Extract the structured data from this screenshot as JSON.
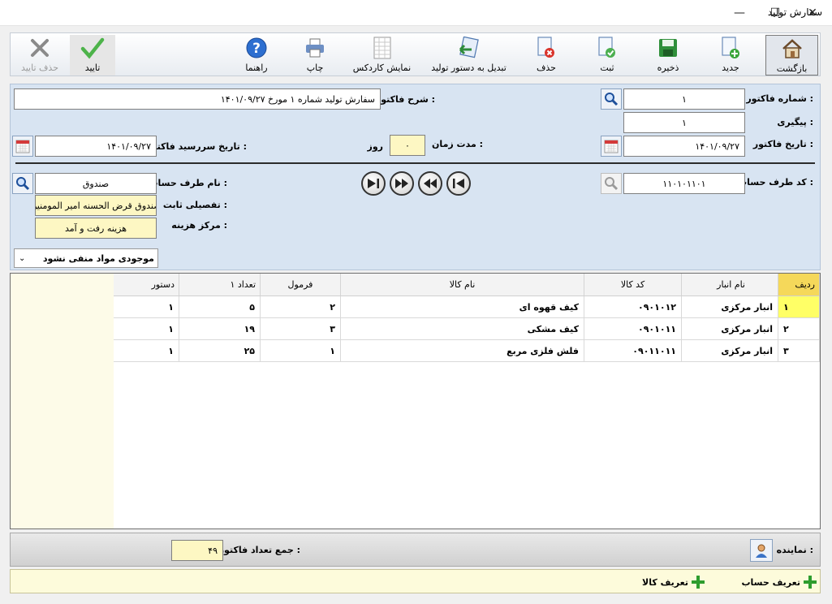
{
  "window": {
    "title": "سفارش تولید",
    "minimize": "—",
    "maximize": "☐",
    "close": "✕"
  },
  "toolbar": {
    "back": "بازگشت",
    "new": "جدید",
    "save": "ذخیره",
    "register": "ثبت",
    "delete": "حذف",
    "convert": "تبدیل به دستور تولید",
    "cardex": "نمایش کاردکس",
    "print": "چاپ",
    "help": "راهنما",
    "confirm": "تایید",
    "delete_confirm": "حذف تایید"
  },
  "form": {
    "invoice_number_label": "شماره فاکتور :",
    "invoice_number": "۱",
    "tracking_label": "پیگیری :",
    "tracking": "۱",
    "description_label": "شرح فاکتور :",
    "description": "سفارش تولید شماره ۱ مورخ ۱۴۰۱/۰۹/۲۷",
    "invoice_date_label": "تاریخ فاکتور :",
    "invoice_date": "۱۴۰۱/۰۹/۲۷",
    "duration_label": "مدت زمان :",
    "duration": "۰",
    "duration_unit": "روز",
    "due_date_label": "تاریخ سررسید فاکتور :",
    "due_date": "۱۴۰۱/۰۹/۲۷",
    "account_code_label": "کد طرف حساب :",
    "account_code": "۱۱۰۱۰۱۱۰۱",
    "account_name_label": "نام طرف حساب :",
    "account_name": "صندوق",
    "detail_label": "تفصیلی ثابت :",
    "detail": "صندوق قرض الحسنه امیر المومنین",
    "cost_center_label": "مرکز هزینه :",
    "cost_center": "هزینه رفت و آمد",
    "stock_option": "موجودی مواد منفی نشود"
  },
  "grid": {
    "columns": [
      "ردیف",
      "نام انبار",
      "کد کالا",
      "نام کالا",
      "فرمول",
      "تعداد ۱",
      "دستور"
    ],
    "rows": [
      [
        "۱",
        "انبار مرکزی",
        "۰۹۰۱۰۱۲",
        "کیف قهوه ای",
        "۲",
        "۵",
        "۱"
      ],
      [
        "۲",
        "انبار مرکزی",
        "۰۹۰۱۰۱۱",
        "کیف مشکی",
        "۳",
        "۱۹",
        "۱"
      ],
      [
        "۳",
        "انبار مرکزی",
        "۰۹۰۱۱۰۱۱",
        "فلش فلزی مربع",
        "۱",
        "۲۵",
        "۱"
      ]
    ]
  },
  "footer": {
    "agent_label": "نماینده :",
    "total_label": "جمع تعداد فاکتور :",
    "total": "۴۹",
    "define_account": "تعریف حساب",
    "define_goods": "تعریف کالا"
  }
}
